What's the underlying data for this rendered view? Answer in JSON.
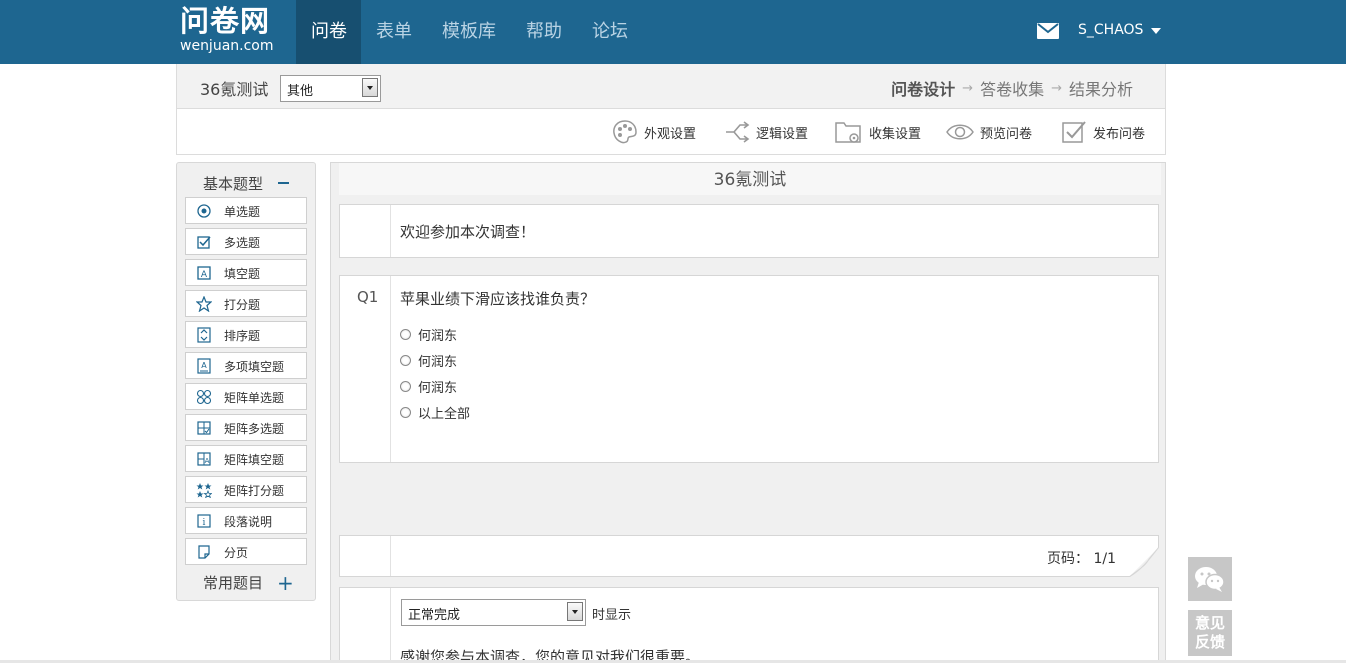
{
  "logo": {
    "cn": "问卷网",
    "en": "wenjuan.com"
  },
  "nav": [
    {
      "label": "问卷",
      "active": true
    },
    {
      "label": "表单",
      "active": false
    },
    {
      "label": "模板库",
      "active": false
    },
    {
      "label": "帮助",
      "active": false
    },
    {
      "label": "论坛",
      "active": false
    }
  ],
  "user": {
    "name": "S_CHAOS"
  },
  "subheader": {
    "title": "36氪测试",
    "category": "其他",
    "steps": [
      "问卷设计",
      "答卷收集",
      "结果分析"
    ]
  },
  "toolbar": [
    "外观设置",
    "逻辑设置",
    "收集设置",
    "预览问卷",
    "发布问卷"
  ],
  "left_panel": {
    "heading": "基本题型",
    "types": [
      "单选题",
      "多选题",
      "填空题",
      "打分题",
      "排序题",
      "多项填空题",
      "矩阵单选题",
      "矩阵多选题",
      "矩阵填空题",
      "矩阵打分题",
      "段落说明",
      "分页"
    ],
    "footer": "常用题目"
  },
  "survey": {
    "title": "36氪测试",
    "welcome": "欢迎参加本次调查！",
    "question": {
      "number": "Q1",
      "text": "苹果业绩下滑应该找谁负责？",
      "options": [
        "何润东",
        "何润东",
        "何润东",
        "以上全部"
      ]
    },
    "page": "页码： 1/1",
    "end": {
      "status": "正常完成",
      "suffix": "时显示",
      "thanks": "感谢您参与本调查，您的意见对我们很重要。"
    }
  },
  "feedback": {
    "line1": "意见",
    "line2": "反馈"
  },
  "colors": {
    "brand": "#1e6690",
    "nav_active": "#174f70"
  }
}
